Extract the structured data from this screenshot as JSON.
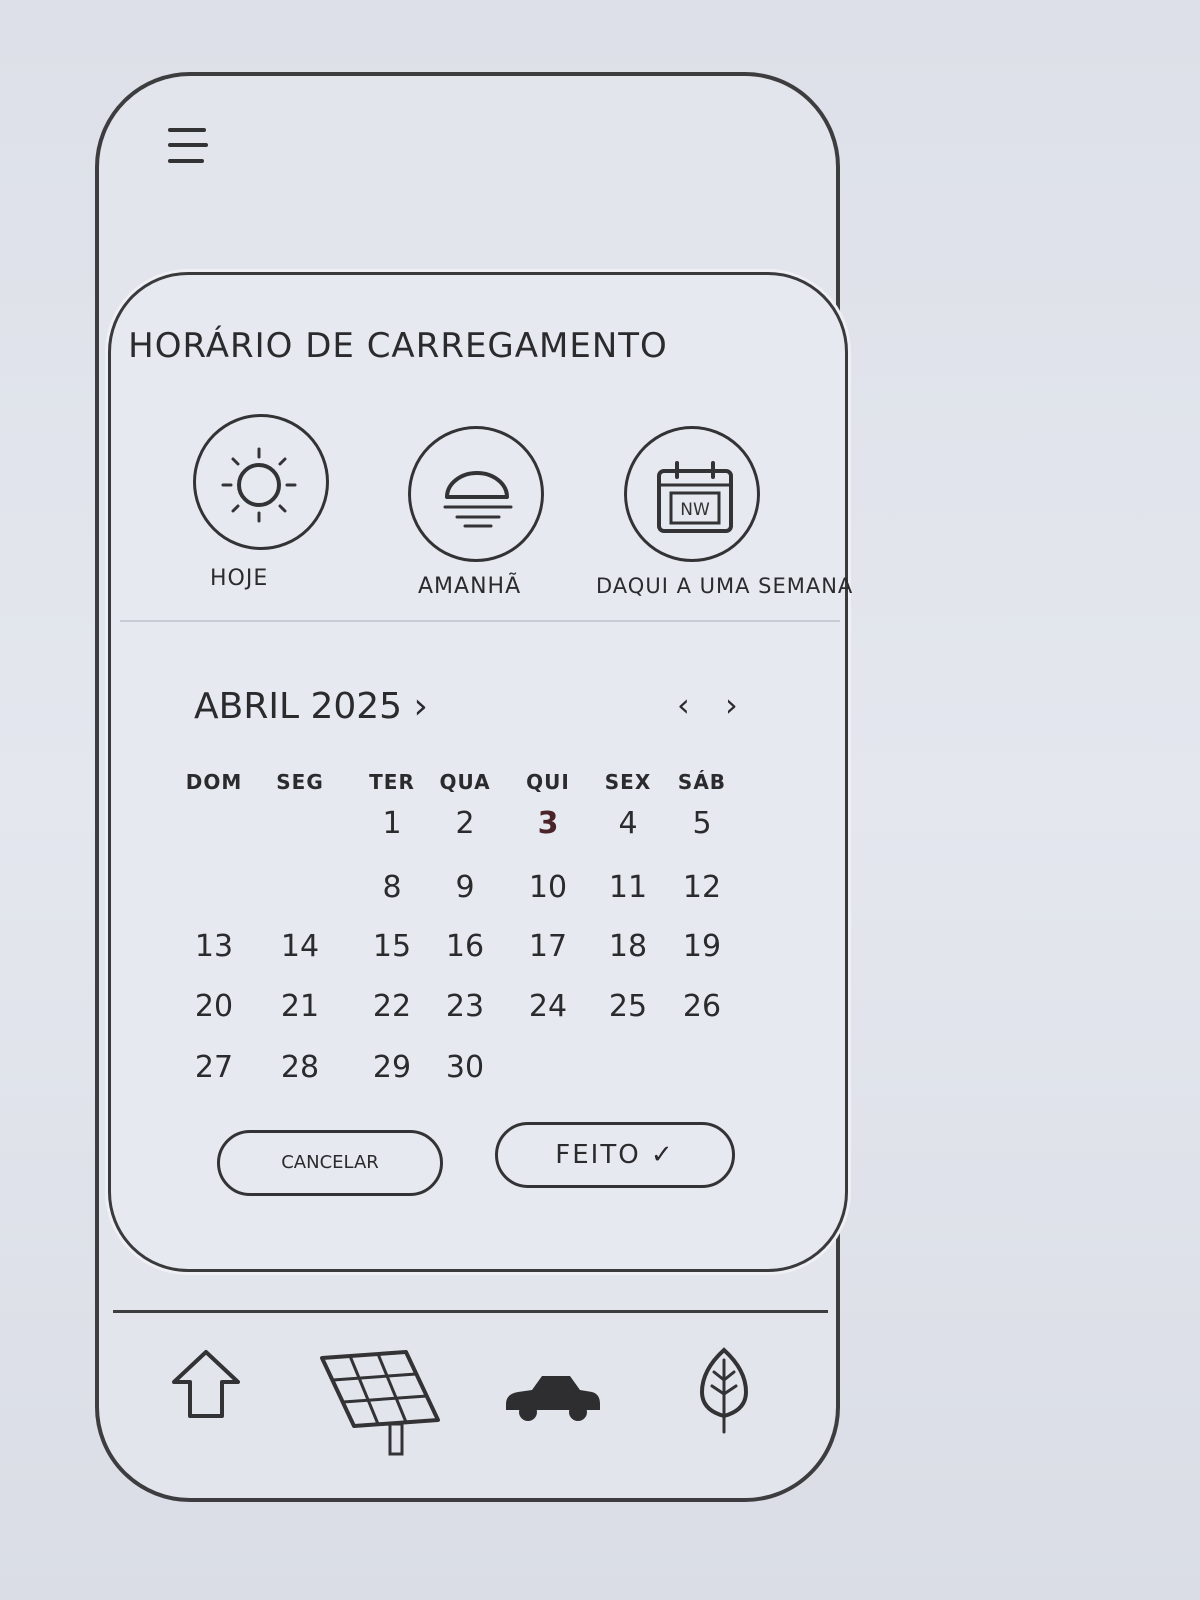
{
  "menu": {
    "icon": "menu-icon"
  },
  "modal": {
    "title": "HORÁRIO DE CARREGAMENTO",
    "shortcuts": [
      {
        "label": "HOJE",
        "icon": "sun-icon"
      },
      {
        "label": "AMANHÃ",
        "icon": "sunrise-icon"
      },
      {
        "label": "DAQUI A UMA SEMANA",
        "icon": "calendar-next-week-icon",
        "icon_text": "NW"
      }
    ],
    "calendar": {
      "month_label": "ABRIL 2025 ›",
      "prev_label": "‹",
      "next_label": "›",
      "weekdays": [
        "DOM",
        "SEG",
        "TER",
        "QUA",
        "QUI",
        "SEX",
        "SÁB"
      ],
      "selected_day": "3",
      "weeks": [
        [
          "",
          "",
          "1",
          "2",
          "3",
          "4",
          "5"
        ],
        [
          "",
          "",
          "8",
          "9",
          "10",
          "11",
          "12"
        ],
        [
          "13",
          "14",
          "15",
          "16",
          "17",
          "18",
          "19"
        ],
        [
          "20",
          "21",
          "22",
          "23",
          "24",
          "25",
          "26"
        ],
        [
          "27",
          "28",
          "29",
          "30",
          "",
          "",
          ""
        ]
      ]
    },
    "buttons": {
      "cancel": "CANCELAR",
      "done": "FEITO ✓"
    }
  },
  "bottom_nav": [
    {
      "icon": "home-icon"
    },
    {
      "icon": "solar-panel-icon"
    },
    {
      "icon": "car-icon"
    },
    {
      "icon": "leaf-icon"
    }
  ],
  "colors": {
    "ink": "#333336",
    "paper": "#e2e5ec",
    "selected_day": "#4a2428"
  }
}
